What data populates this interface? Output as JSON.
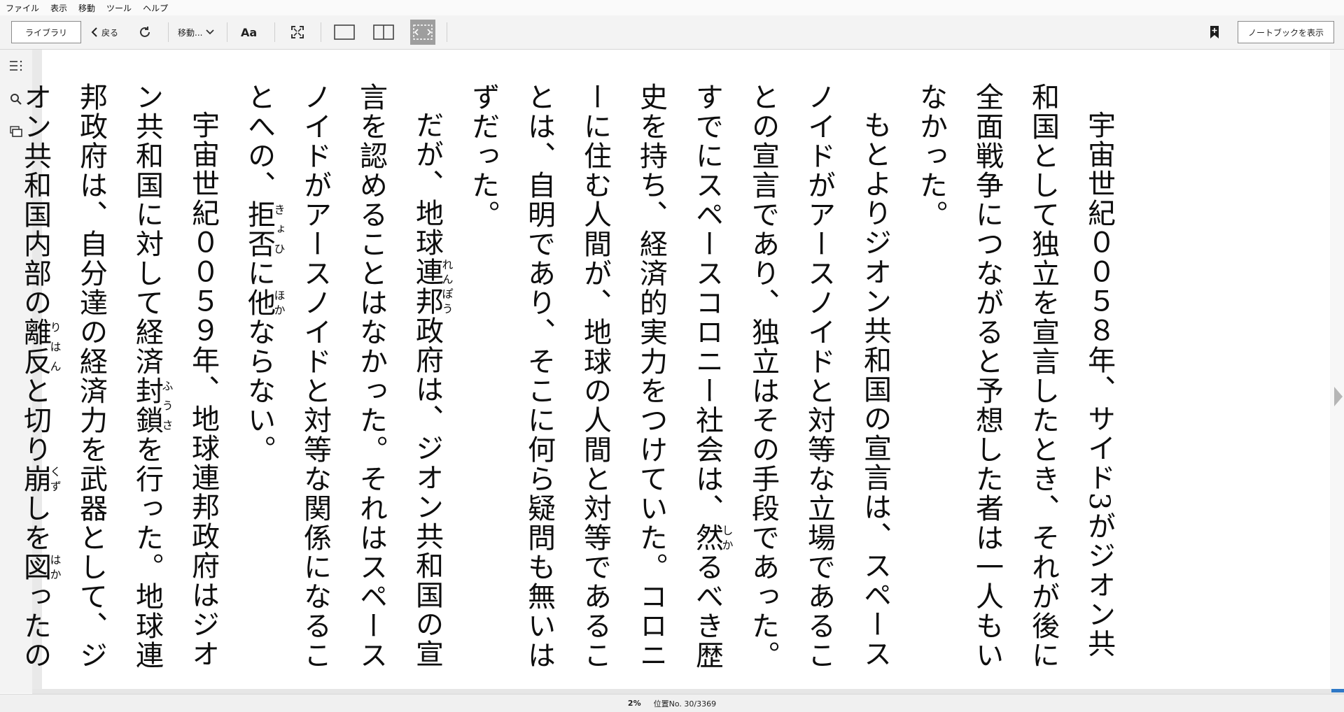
{
  "menubar": {
    "items": [
      "ファイル",
      "表示",
      "移動",
      "ツール",
      "ヘルプ"
    ]
  },
  "toolbar": {
    "library_label": "ライブラリ",
    "back_label": "戻る",
    "goto_label": "移動...",
    "font_label": "Aa",
    "notebook_label": "ノートブックを表示"
  },
  "icons": {
    "sidebar": [
      "table-of-contents-icon",
      "search-icon",
      "flashcards-icon"
    ],
    "toolbar": [
      "back-chevron-icon",
      "sync-icon",
      "chevron-down-icon",
      "fullscreen-icon",
      "single-column-icon",
      "two-column-icon",
      "fit-width-icon",
      "add-bookmark-icon"
    ]
  },
  "colors": {
    "toolbar_bg": "#f3f3f3",
    "active_layout_bg": "#9e9e9e",
    "progress_blue": "#2e78c7"
  },
  "text": {
    "p1": "宇宙世紀００５８年、サイド3がジオン共和国として独立を宣言したとき、それが後に全面戦争につながると予想した者は一人もいなかった。",
    "p2a": "もとよりジオン共和国の宣言は、スペースノイドがアースノイドと対等な立場であることの宣言であり、独立はその手段であった。すでにスペースコロニー社会は、",
    "p2_ruby_base": "然",
    "p2_ruby_text": "しか",
    "p2b": "るべき歴史を持ち、経済的実力をつけていた。コロニーに住む人間が、地球の人間と対等であることは、自明であり、そこに何ら疑問も無いはずだった。",
    "p3a": "だが、地球",
    "p3_ruby_base": "連邦",
    "p3_ruby_text": "れんぽう",
    "p3b": "政府は、ジオン共和国の宣言を認めることはなかった。それはスペースノイドがアースノイドと対等な関係になることへの、",
    "p3_ruby2_base": "拒否",
    "p3_ruby2_text": "きょひ",
    "p3c": "に",
    "p3_ruby3_base": "他",
    "p3_ruby3_text": "ほか",
    "p3d": "ならない。",
    "p4a": "宇宙世紀００５９年、地球連邦政府はジオン共和国に対して経済",
    "p4_ruby_base": "封鎖",
    "p4_ruby_text": "ふうさ",
    "p4b": "を行った。地球連邦政府は、自分達の経済力を武器として、ジオン共和国内部の",
    "p4_ruby2_base": "離反",
    "p4_ruby2_text": "りはん",
    "p4c": "と切り",
    "p4_ruby3_base": "崩",
    "p4_ruby3_text": "くず",
    "p4d": "しを",
    "p4_ruby4_base": "図",
    "p4_ruby4_text": "はか",
    "p4e": "ったのである。"
  },
  "status": {
    "percent": "2%",
    "location": "位置No. 30/3369"
  }
}
